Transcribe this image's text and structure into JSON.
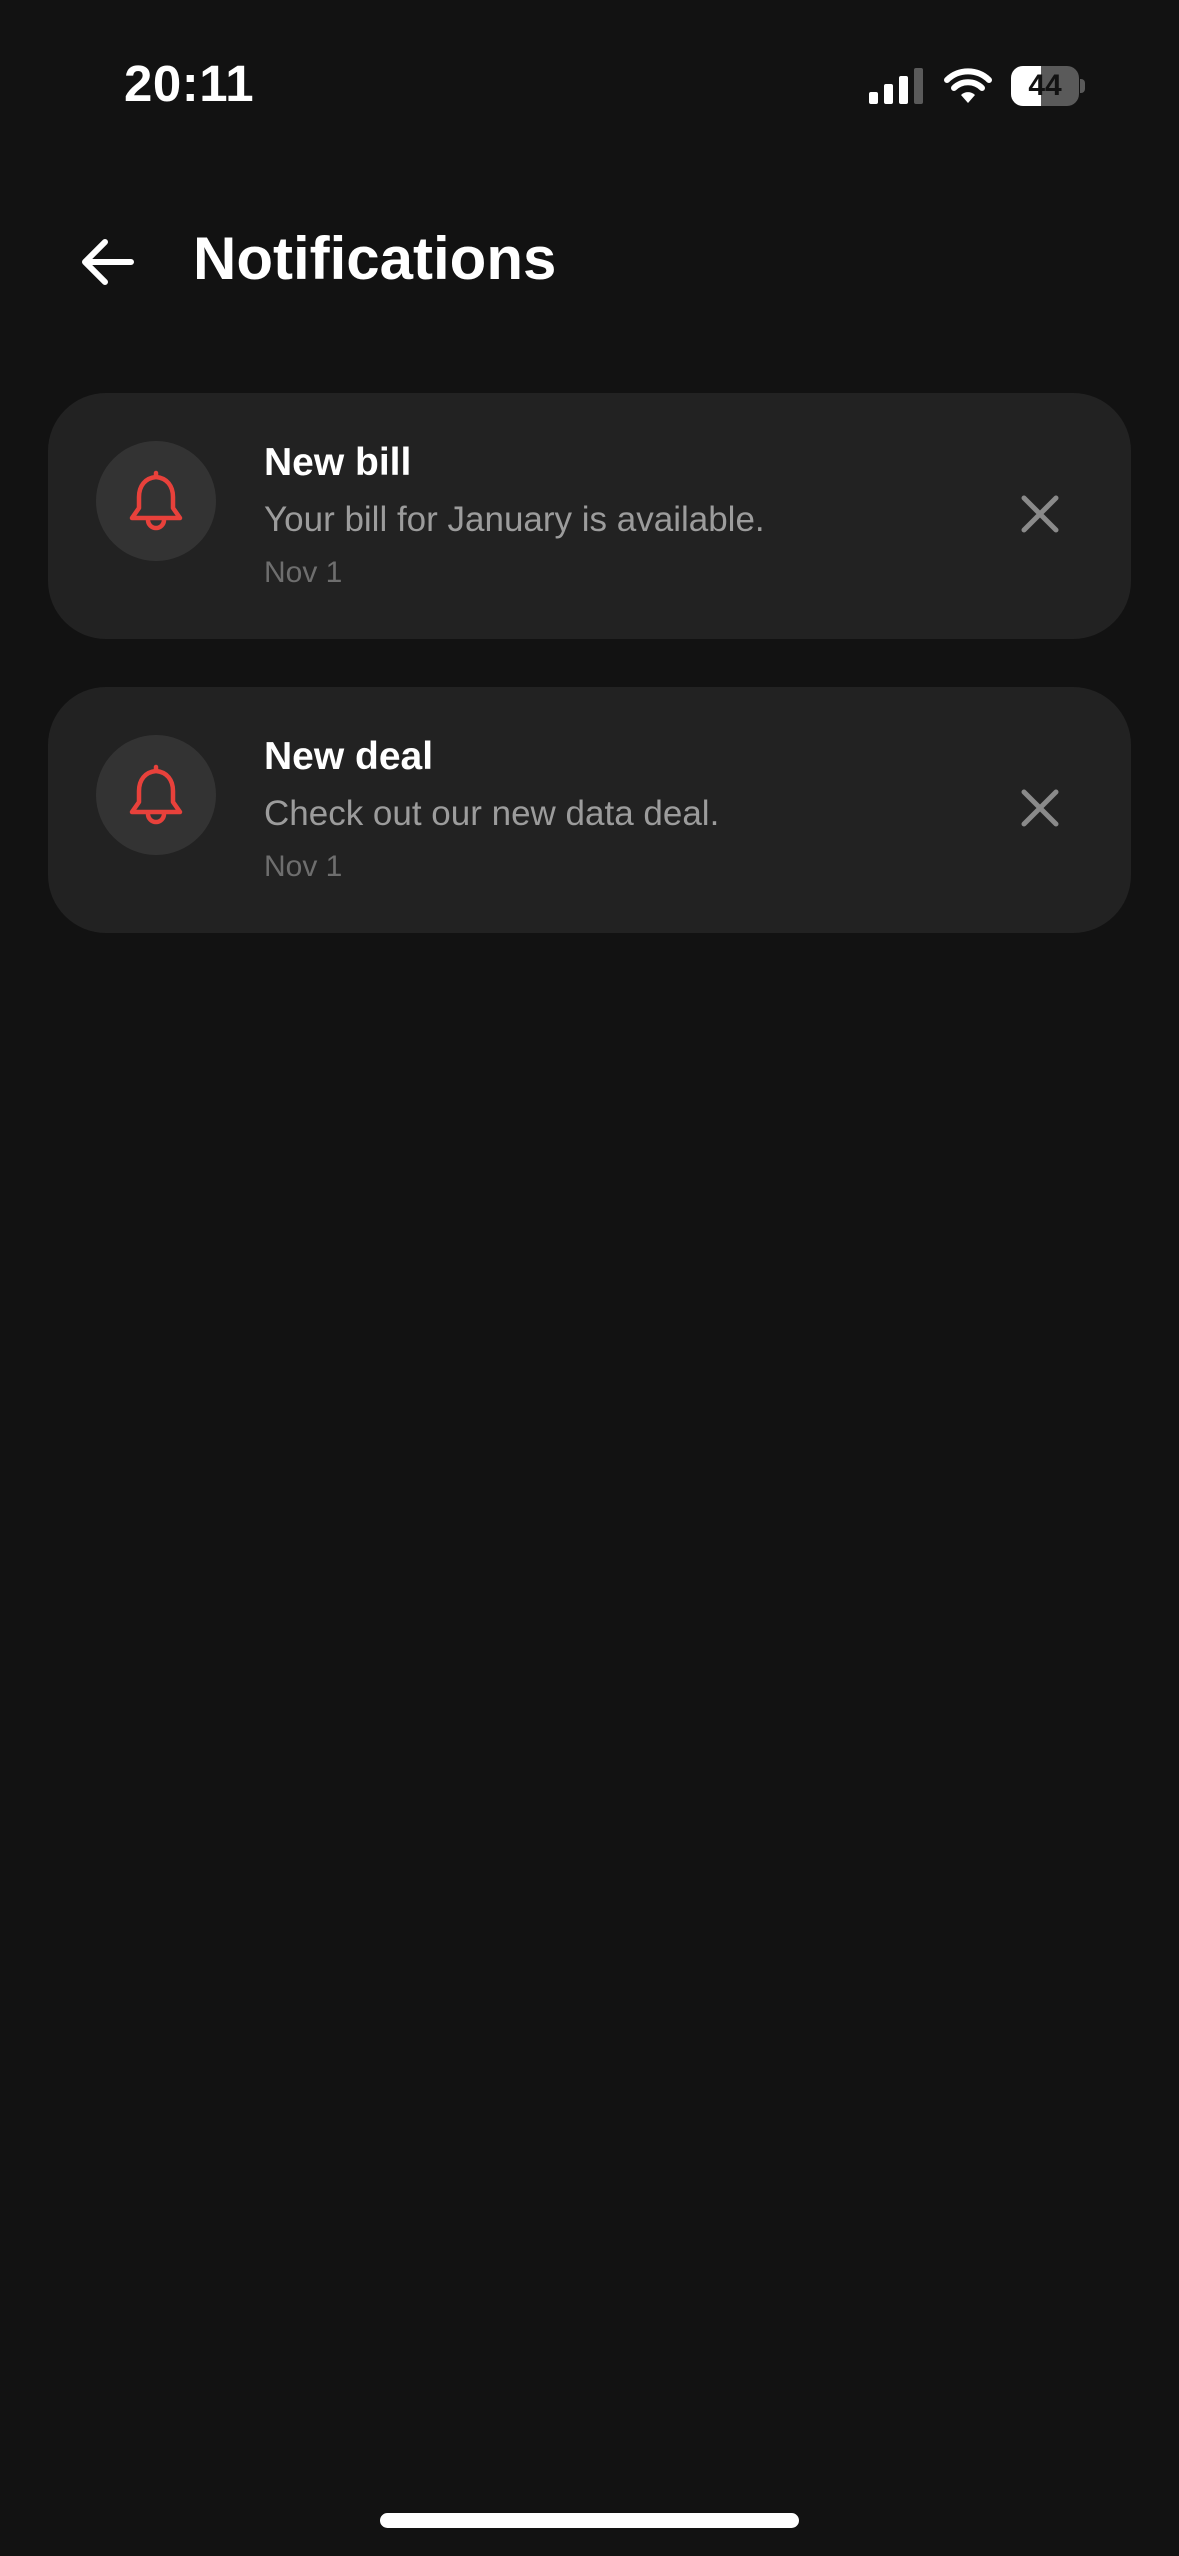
{
  "status_bar": {
    "time": "20:11",
    "battery_level": "44",
    "battery_fraction": 0.44,
    "icons": [
      "signal-icon",
      "wifi-icon",
      "battery-icon"
    ]
  },
  "header": {
    "back_icon": "arrow-left-icon",
    "title": "Notifications"
  },
  "notifications": [
    {
      "icon": "bell-icon",
      "title": "New bill",
      "message": "Your bill for January is available.",
      "date": "Nov 1",
      "dismiss_icon": "close-icon"
    },
    {
      "icon": "bell-icon",
      "title": "New deal",
      "message": "Check out our new data deal.",
      "date": "Nov 1",
      "dismiss_icon": "close-icon"
    }
  ],
  "colors": {
    "background": "#121212",
    "card": "#222222",
    "icon_circle": "#333333",
    "accent_red": "#E8413B",
    "text_primary": "#FFFFFF",
    "text_secondary": "#9C9C9C",
    "text_tertiary": "#6E6E6E",
    "dismiss": "#8A8A8A"
  }
}
